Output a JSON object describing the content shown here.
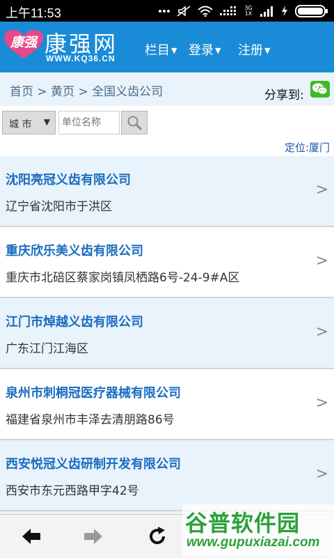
{
  "status_bar": {
    "time": "上午11:53",
    "network_top": "3G",
    "network_bottom": "1X"
  },
  "header": {
    "logo_badge": "康强",
    "logo_name": "康强网",
    "logo_url": "WWW.KQ36.CN",
    "nav": [
      {
        "label": "栏目"
      },
      {
        "label": "登录"
      },
      {
        "label": "注册"
      }
    ]
  },
  "breadcrumb": {
    "text": "首页 > 黄页 > 全国义齿公司",
    "share_label": "分享到:"
  },
  "search": {
    "city_label": "城 市",
    "unit_placeholder": "单位名称"
  },
  "location": {
    "label": "定位:厦门"
  },
  "companies": [
    {
      "name": "沈阳亮冠义齿有限公司",
      "address": "辽宁省沈阳市于洪区"
    },
    {
      "name": "重庆欣乐美义齿有限公司",
      "address": "重庆市北碚区蔡家岗镇凤栖路6号-24-9#A区"
    },
    {
      "name": "江门市焯越义齿有限公司",
      "address": "广东江门江海区"
    },
    {
      "name": "泉州市刺桐冠医疗器械有限公司",
      "address": "福建省泉州市丰泽去清朋路86号"
    },
    {
      "name": "西安悦冠义齿研制开发有限公司",
      "address": "西安市东元西路甲字42号"
    }
  ],
  "chevron": ">",
  "watermark": {
    "title": "谷普软件园",
    "url": "www.gupuxiazai.com"
  },
  "colors": {
    "header_blue": "#1a8bd6",
    "link_blue": "#1a6cc0",
    "row_tint": "#e9f3fb",
    "watermark_green": "#2aa23a"
  }
}
